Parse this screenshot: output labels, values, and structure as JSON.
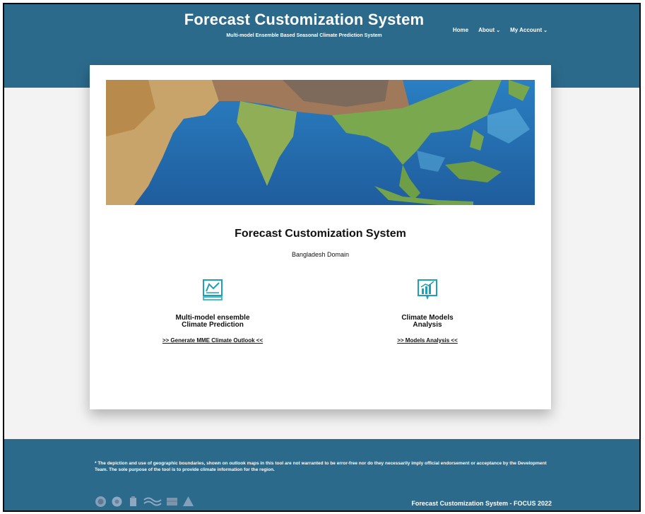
{
  "header": {
    "title": "Forecast Customization System",
    "subtitle": "Multi-model Ensemble Based Seasonal Climate Prediction System",
    "nav": {
      "home": "Home",
      "about": "About",
      "account": "My Account"
    }
  },
  "main": {
    "banner_alt": "Map of South and Southeast Asia",
    "title": "Forecast Customization System",
    "domain": "Bangladesh Domain",
    "features": [
      {
        "icon": "chart-board-icon",
        "title_line1": "Multi-model ensemble",
        "title_line2": "Climate Prediction",
        "link": ">> Generate MME Climate Outlook <<"
      },
      {
        "icon": "bar-chart-icon",
        "title_line1": "Climate Models",
        "title_line2": "Analysis",
        "link": ">> Models Analysis <<"
      }
    ]
  },
  "footer": {
    "disclaimer": "* The depiction and use of geographic boundaries, shown on outlook maps in this tool are not warranted to be error-free nor do they necessarily imply official endorsement or acceptance by the Development Team. The sole purpose of the tool is to provide climate information for the region.",
    "copyright": "Forecast Customization System - FOCUS 2022",
    "logos": [
      "wmo-logo",
      "partner-logo",
      "institute-logo",
      "waves-logo",
      "flag-logo",
      "rimes-logo"
    ]
  },
  "colors": {
    "header_bg": "#2c6a8c",
    "accent_icon": "#1aa3b6",
    "page_bg": "#f3f3f3"
  }
}
